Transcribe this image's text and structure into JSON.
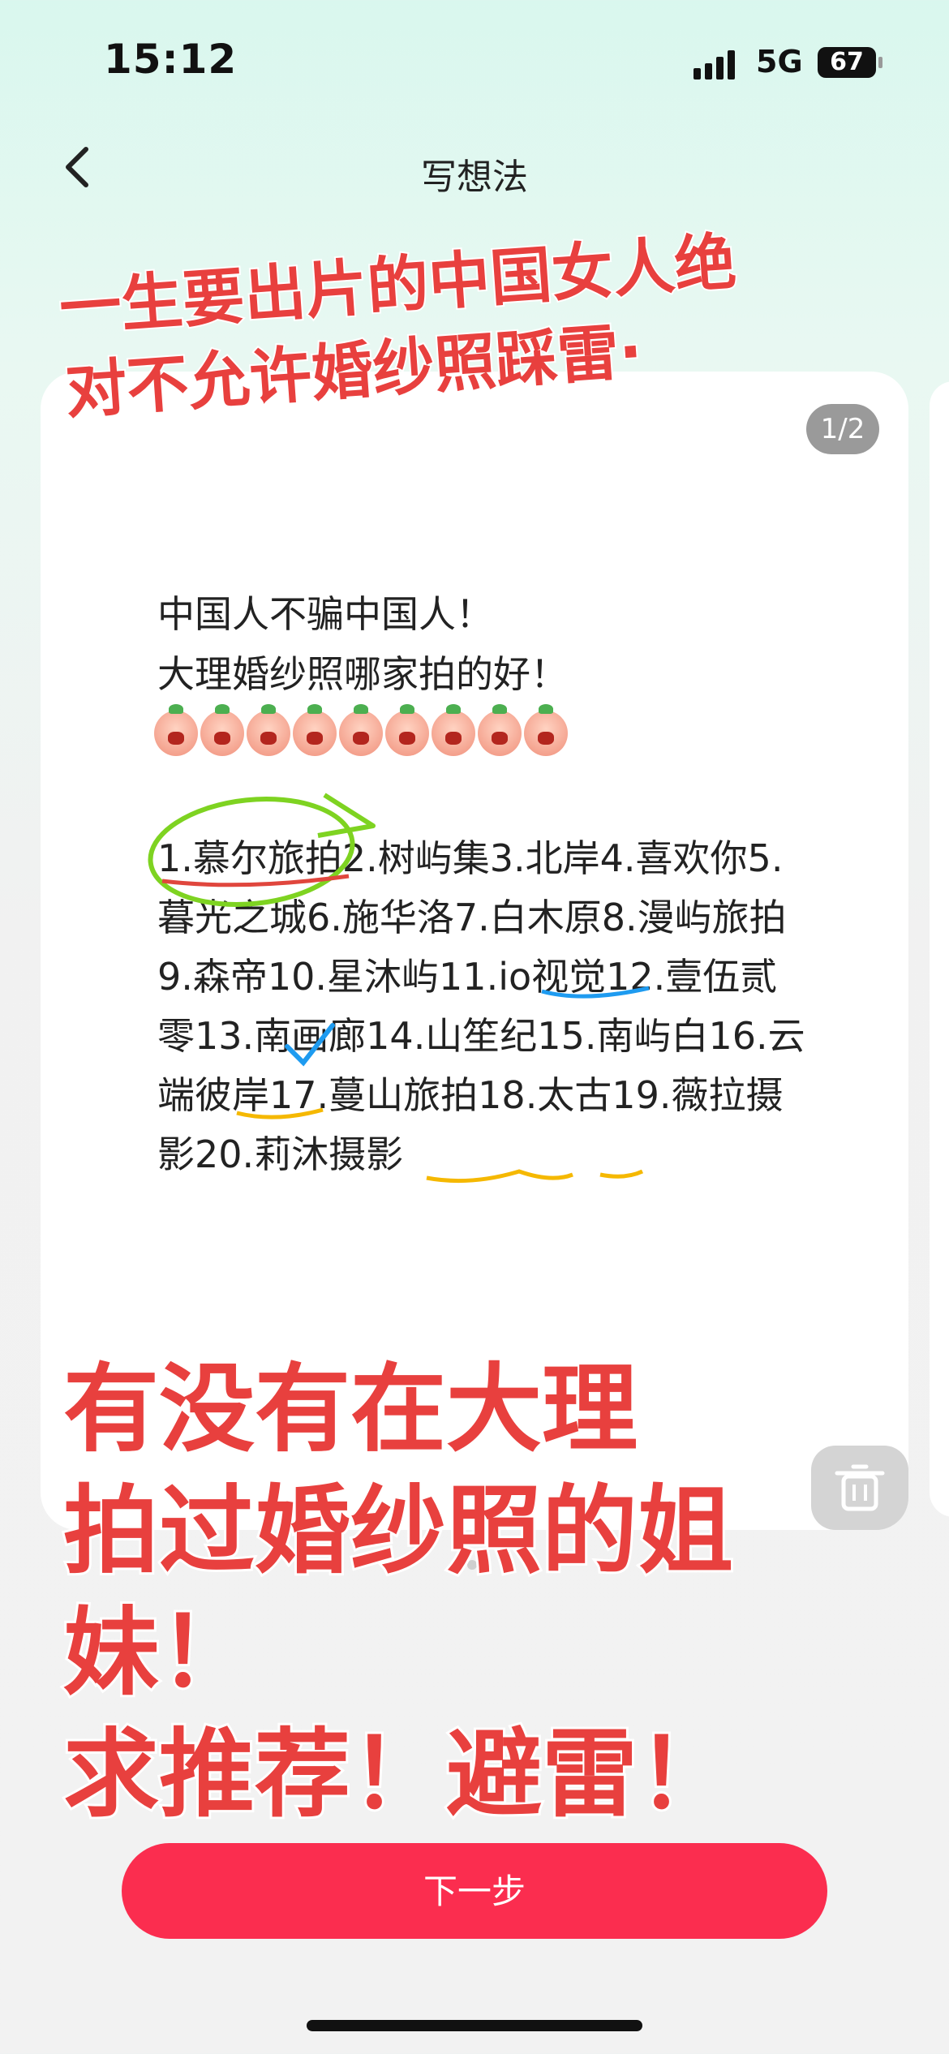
{
  "status_bar": {
    "time": "15:12",
    "network": "5G",
    "battery": "67"
  },
  "nav": {
    "title": "写想法"
  },
  "overlay": {
    "top_lines": [
      "一生要出片的中国女人绝",
      "对不允许婚纱照踩雷·"
    ],
    "bottom_lines": [
      "有没有在大理",
      "拍过婚纱照的姐妹！",
      "求推荐！避雷！"
    ]
  },
  "card": {
    "page_indicator": "1/2",
    "line1": "中国人不骗中国人！",
    "line2": "大理婚纱照哪家拍的好！",
    "list": "1.慕尔旅拍2.树屿集3.北岸4.喜欢你5.暮光之城6.施华洛7.白木原8.漫屿旅拍9.森帝10.星沐屿11.io视觉12.壹伍贰零13.南画廊14.山笙纪15.南屿白16.云端彼岸17.蔓山旅拍18.太古19.薇拉摄影20.莉沐摄影"
  },
  "footer": {
    "next_label": "下一步"
  },
  "colors": {
    "accent": "#fb2d4f",
    "overlay_red": "#e8403e",
    "green_mark": "#7ed321",
    "blue_mark": "#1e9bf0",
    "yellow_mark": "#f5b800"
  }
}
